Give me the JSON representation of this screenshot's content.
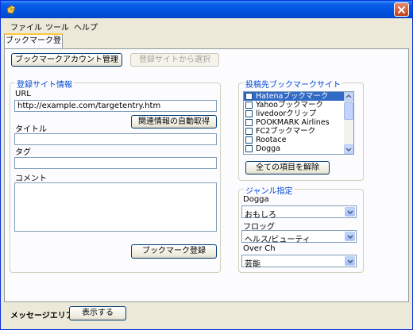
{
  "window": {
    "title": ""
  },
  "menu": [
    "ファイル",
    "ツール",
    "ヘルプ"
  ],
  "tab": {
    "label": "ブックマーク登録"
  },
  "buttons": {
    "account": "ブックマークアカウント管理",
    "select_site": "登録サイトから選択",
    "auto_fetch": "関連情報の自動取得",
    "register": "ブックマーク登録",
    "uncheck_all": "全ての項目を解除",
    "show": "表示する"
  },
  "site_info": {
    "group_title": "登録サイト情報",
    "url_label": "URL",
    "url_value": "http://example.com/targetentry.htm",
    "title_label": "タイトル",
    "title_value": "",
    "tag_label": "タグ",
    "tag_value": "",
    "comment_label": "コメント",
    "comment_value": ""
  },
  "targets": {
    "group_title": "投稿先ブックマークサイト",
    "items": [
      {
        "label": "Hatenaブックマーク",
        "selected": true
      },
      {
        "label": "Yahooブックマーク",
        "selected": false
      },
      {
        "label": "livedoorクリップ",
        "selected": false
      },
      {
        "label": "POOKMARK Airlines",
        "selected": false
      },
      {
        "label": "FC2ブックマーク",
        "selected": false
      },
      {
        "label": "Rootace",
        "selected": false
      },
      {
        "label": "Dogga",
        "selected": false
      }
    ]
  },
  "genre": {
    "group_title": "ジャンル指定",
    "fields": [
      {
        "label": "Dogga",
        "value": "おもしろ"
      },
      {
        "label": "フロッグ",
        "value": "ヘルス/ビューティ"
      },
      {
        "label": "Over Ch",
        "value": "芸能"
      }
    ]
  },
  "status": {
    "label": "メッセージエリア"
  }
}
